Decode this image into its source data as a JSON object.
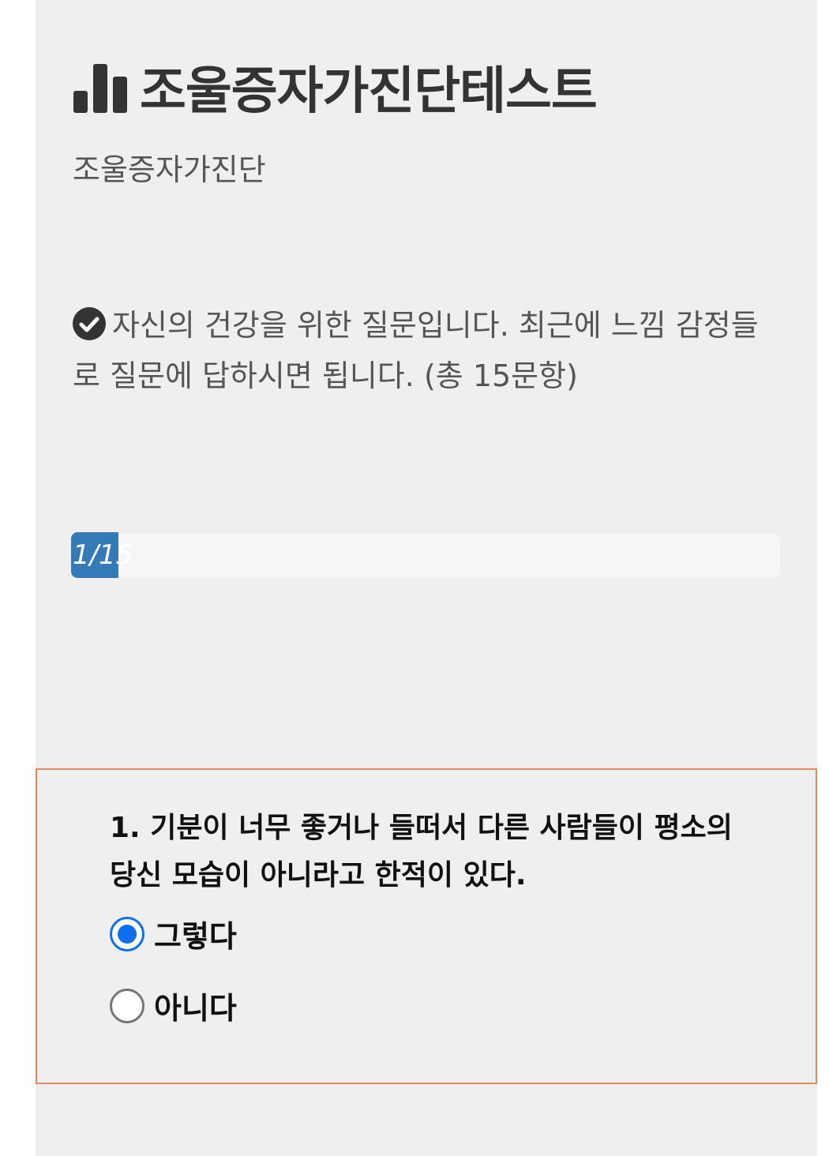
{
  "header": {
    "title": "조울증자가진단테스트",
    "icon": "bar-chart-icon",
    "subtitle": "조울증자가진단"
  },
  "intro": {
    "icon": "check-circle-icon",
    "text": "자신의 건강을 위한 질문입니다. 최근에 느낌 감정들로 질문에 답하시면 됩니다. (총 15문항)"
  },
  "progress": {
    "label": "1/15",
    "current": 1,
    "total": 15,
    "color": "#337ab7"
  },
  "question": {
    "text": "1. 기분이 너무 좋거나 들떠서 다른 사람들이 평소의 당신 모습이 아니라고 한적이 있다.",
    "options": [
      {
        "label": "그렇다",
        "selected": true
      },
      {
        "label": "아니다",
        "selected": false
      }
    ],
    "border_color": "#e08a5e"
  }
}
